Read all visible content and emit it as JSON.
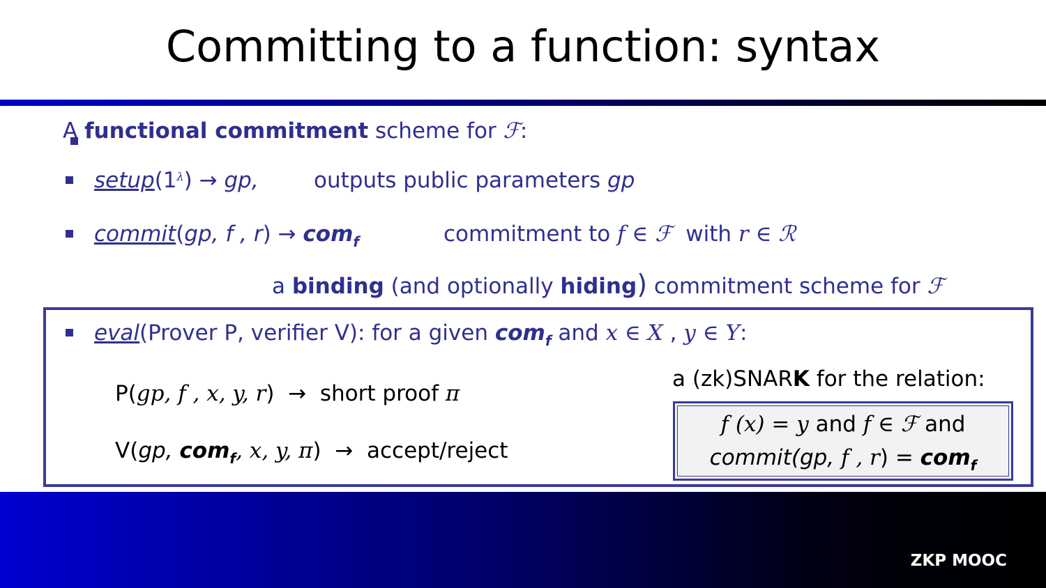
{
  "title": "Committing to a function:  syntax",
  "intro": {
    "prefix": "A ",
    "bold": "functional commitment",
    "middle": " scheme for ",
    "family": "ℱ",
    "suffix": ":"
  },
  "setup": {
    "name": "setup",
    "args": "(1",
    "sup": "λ",
    "close": ")",
    "arrow": " → ",
    "output": "gp,",
    "desc": "outputs public parameters ",
    "desc_var": "gp"
  },
  "commit": {
    "name": "commit",
    "args_open": "(",
    "args": "gp, f , r",
    "args_close": ")",
    "arrow": " → ",
    "out": "com",
    "out_sub": "f",
    "desc_a": "commitment to ",
    "desc_b": "f ∈ ℱ",
    "desc_c": "with ",
    "desc_d": "r ∈ ℛ"
  },
  "binding_line": {
    "a": "a ",
    "b": "binding",
    "c": " (and optionally ",
    "d": "hiding",
    "e": ")",
    "f": " commitment scheme for ",
    "g": "ℱ"
  },
  "eval": {
    "name": "eval",
    "rest": "(Prover P,  verifier V):   for a given ",
    "com": "com",
    "com_sub": "f",
    "and": " and ",
    "x": "x ∈ X",
    "comma": " , ",
    "y": "y ∈ Y",
    "colon": ":"
  },
  "prover": {
    "prefix": "P(",
    "args": "gp, f , x, y, r",
    "close": ")",
    "arrow": "→",
    "desc": "short proof ",
    "pi": "π"
  },
  "verifier": {
    "prefix": "V(",
    "gp": "gp, ",
    "com": "com",
    "com_sub": "f",
    "args": ", x, y, π",
    "close": ")",
    "arrow": "→",
    "desc": "accept/reject"
  },
  "snark": {
    "label_a": "a (zk)SNAR",
    "label_b": "K",
    "label_c": " for the relation:",
    "line1_a": "f (x) = y",
    "line1_b": " and ",
    "line1_c": "f ∈ ℱ",
    "line1_d": " and",
    "line2_a": "commit",
    "line2_b": "(gp, ",
    "line2_c": "f , r",
    "line2_d": ") = ",
    "line2_e": "com",
    "line2_sub": "f"
  },
  "footer": "ZKP MOOC",
  "colors": {
    "accent": "#2f2f8f",
    "box_border": "#3a3a9a",
    "footer_start": "#0000d0",
    "footer_end": "#000000"
  }
}
